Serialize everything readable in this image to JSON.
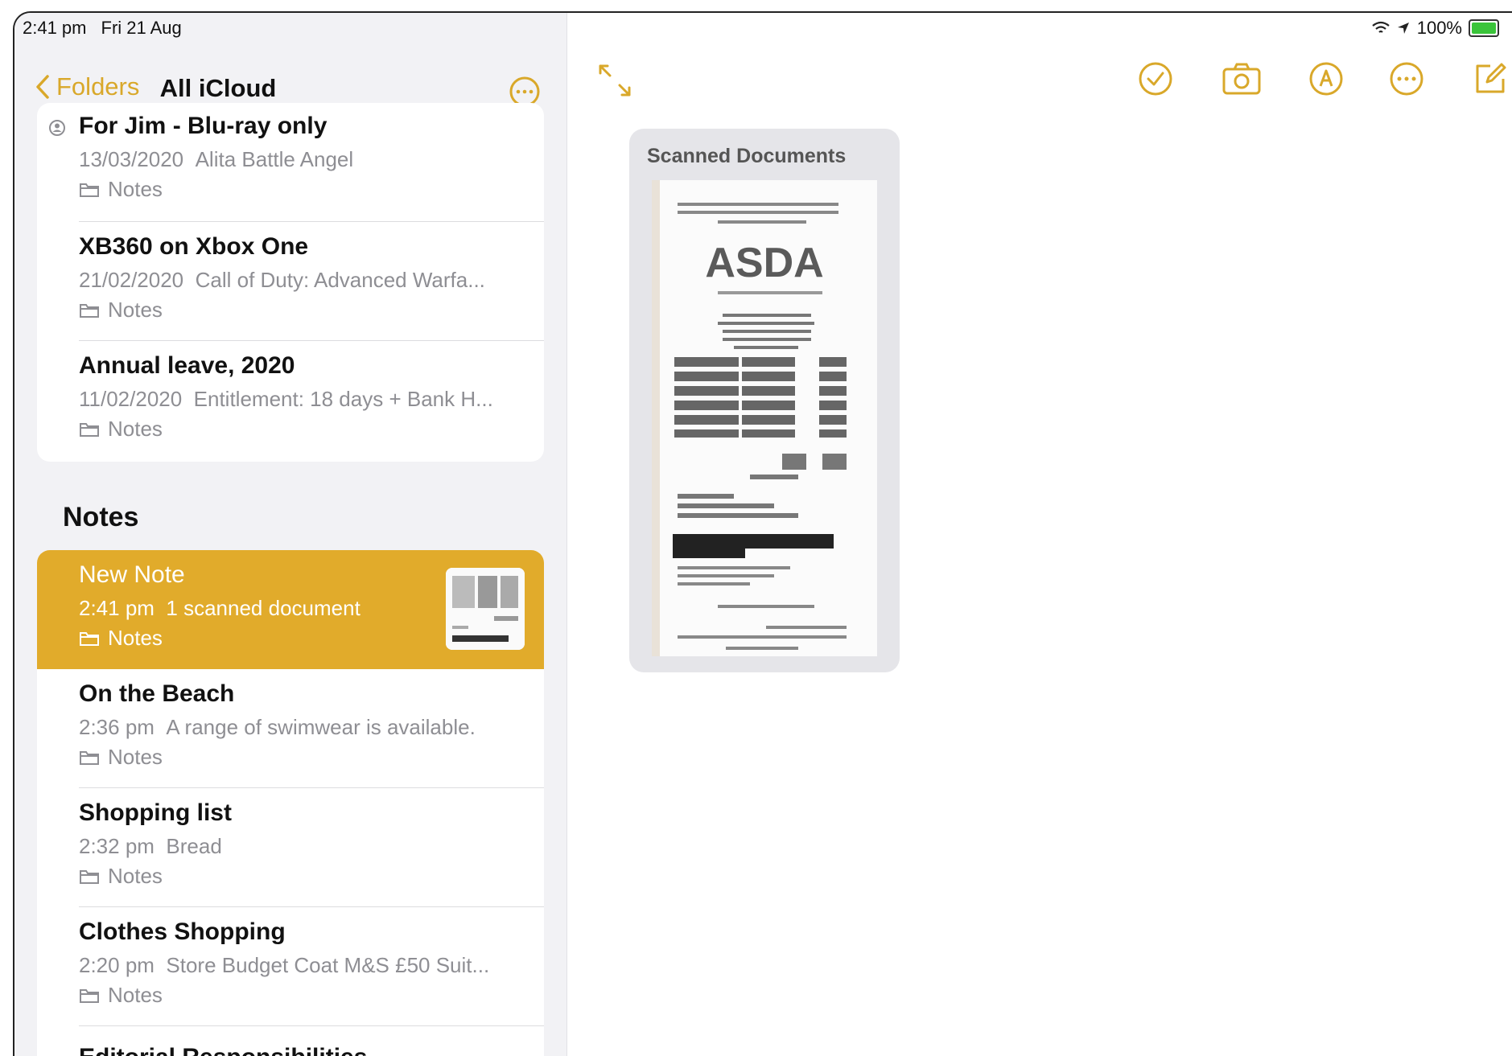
{
  "status": {
    "time": "2:41 pm",
    "date": "Fri 21 Aug",
    "battery": "100%"
  },
  "sidebar": {
    "back_label": "Folders",
    "title": "All iCloud",
    "pinned": [
      {
        "title": "For Jim - Blu-ray only",
        "date": "13/03/2020",
        "preview": "Alita Battle Angel",
        "folder": "Notes"
      },
      {
        "title": "XB360 on Xbox One",
        "date": "21/02/2020",
        "preview": "Call of Duty: Advanced Warfa...",
        "folder": "Notes"
      },
      {
        "title": "Annual leave, 2020",
        "date": "11/02/2020",
        "preview": "Entitlement: 18 days + Bank H...",
        "folder": "Notes"
      }
    ],
    "section_title": "Notes",
    "notes": [
      {
        "title": "New Note",
        "date": "2:41 pm",
        "preview": "1 scanned document",
        "folder": "Notes",
        "selected": true
      },
      {
        "title": "On the Beach",
        "date": "2:36 pm",
        "preview": "A range of swimwear is available.",
        "folder": "Notes"
      },
      {
        "title": "Shopping list",
        "date": "2:32 pm",
        "preview": "Bread",
        "folder": "Notes"
      },
      {
        "title": "Clothes Shopping",
        "date": "2:20 pm",
        "preview": "Store Budget Coat M&S £50 Suit...",
        "folder": "Notes"
      },
      {
        "title": "Editorial Responsibilities",
        "date": "",
        "preview": "",
        "folder": ""
      }
    ]
  },
  "editor": {
    "card_title": "Scanned Documents",
    "receipt_brand": "ASDA"
  },
  "colors": {
    "accent": "#e1ab2b",
    "icon": "#d9a82a"
  }
}
